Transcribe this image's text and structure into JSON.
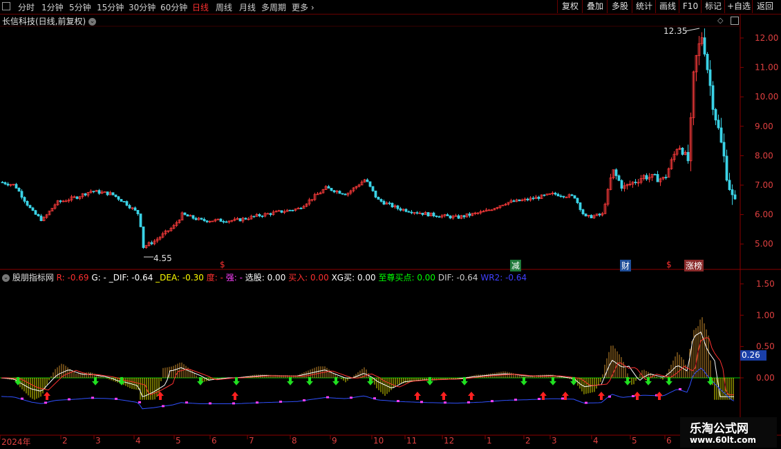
{
  "toolbar": {
    "periods": [
      "分时",
      "1分钟",
      "5分钟",
      "15分钟",
      "30分钟",
      "60分钟",
      "日线",
      "周线",
      "月线",
      "多周期",
      "更多"
    ],
    "active_period": "日线",
    "buttons": [
      "复权",
      "叠加",
      "多股",
      "统计",
      "画线",
      "F10",
      "标记",
      "+自选",
      "返回"
    ]
  },
  "main_panel": {
    "title": "长信科技(日线,前复权)",
    "price_axis": [
      "12.00",
      "11.00",
      "10.00",
      "9.00",
      "8.00",
      "7.00",
      "6.00",
      "5.00"
    ],
    "high_label": "12.35",
    "low_label": "4.55",
    "event_markers": [
      "$",
      "减",
      "财",
      "$",
      "涨榜"
    ]
  },
  "indicator_panel": {
    "name": "股朋指标网",
    "legend": [
      {
        "label": "R: -0.69",
        "color": "#ff3030"
      },
      {
        "label": "G: -",
        "color": "#ffffff"
      },
      {
        "label": "_DIF: -0.64",
        "color": "#ffffff"
      },
      {
        "label": "_DEA: -0.30",
        "color": "#ffff00"
      },
      {
        "label": "度: -",
        "color": "#ff3030"
      },
      {
        "label": "强: -",
        "color": "#ff40ff"
      },
      {
        "label": "选股: 0.00",
        "color": "#ffffff"
      },
      {
        "label": "买入: 0.00",
        "color": "#ff3030"
      },
      {
        "label": "XG买: 0.00",
        "color": "#ffffff"
      },
      {
        "label": "至尊买点: 0.00",
        "color": "#00ff00"
      },
      {
        "label": "DIF: -0.64",
        "color": "#cccccc"
      },
      {
        "label": "WR2: -0.64",
        "color": "#4040ff"
      }
    ],
    "axis": [
      "1.50",
      "1.00",
      "0.50",
      "0.00"
    ],
    "current_value": "0.26"
  },
  "date_axis": [
    "2024年",
    "2",
    "3",
    "4",
    "5",
    "6",
    "7",
    "8",
    "9",
    "10",
    "11",
    "12",
    "1",
    "2",
    "3",
    "4",
    "5",
    "6"
  ],
  "watermark": {
    "line1": "乐淘公式网",
    "line2": "www.60lt.com"
  }
}
